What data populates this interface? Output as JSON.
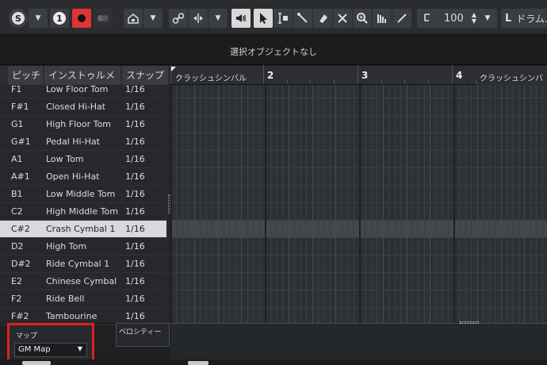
{
  "toolbar": {
    "solo_label": "S",
    "one_label": "1",
    "zoom_value": "100",
    "drum_track_label": "L",
    "drum_track_name": "ドラム..."
  },
  "info": {
    "status_text": "選択オブジェクトなし"
  },
  "list": {
    "headers": [
      "ピッチ",
      "インストゥルメント",
      "スナップ"
    ],
    "rows": [
      {
        "pitch": "F1",
        "instrument": "Low Floor Tom",
        "snap": "1/16"
      },
      {
        "pitch": "F#1",
        "instrument": "Closed Hi-Hat",
        "snap": "1/16"
      },
      {
        "pitch": "G1",
        "instrument": "High Floor Tom",
        "snap": "1/16"
      },
      {
        "pitch": "G#1",
        "instrument": "Pedal Hi-Hat",
        "snap": "1/16"
      },
      {
        "pitch": "A1",
        "instrument": "Low Tom",
        "snap": "1/16"
      },
      {
        "pitch": "A#1",
        "instrument": "Open Hi-Hat",
        "snap": "1/16"
      },
      {
        "pitch": "B1",
        "instrument": "Low Middle Tom",
        "snap": "1/16"
      },
      {
        "pitch": "C2",
        "instrument": "High Middle Tom",
        "snap": "1/16"
      },
      {
        "pitch": "C#2",
        "instrument": "Crash Cymbal 1",
        "snap": "1/16",
        "selected": true
      },
      {
        "pitch": "D2",
        "instrument": "High Tom",
        "snap": "1/16"
      },
      {
        "pitch": "D#2",
        "instrument": "Ride Cymbal 1",
        "snap": "1/16"
      },
      {
        "pitch": "E2",
        "instrument": "Chinese Cymbal",
        "snap": "1/16"
      },
      {
        "pitch": "F2",
        "instrument": "Ride Bell",
        "snap": "1/16"
      },
      {
        "pitch": "F#2",
        "instrument": "Tambourine",
        "snap": "1/16"
      }
    ]
  },
  "ruler": {
    "cue_left": "クラッシュシンバル",
    "cue_right": "クラッシュシンバル",
    "bars": [
      "2",
      "3",
      "4"
    ]
  },
  "velocity": {
    "label": "ベロシティー"
  },
  "map": {
    "label": "マップ",
    "value": "GM Map"
  },
  "colors": {
    "record": "#e03434",
    "highlight_border": "#e02020",
    "selected_row": "#d7d9dc"
  }
}
